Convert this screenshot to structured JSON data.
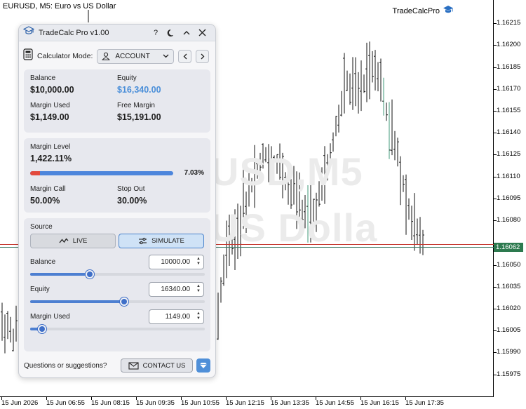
{
  "chart": {
    "symbol_label": "EURUSD, M5:  Euro vs US Dollar",
    "indicator_label": "TradeCalcPro",
    "watermark_line1": "USD,M5",
    "watermark_line2": "US Dolla",
    "current_price": "1.16062",
    "price_ticks": [
      "1.16215",
      "1.16200",
      "1.16185",
      "1.16170",
      "1.16155",
      "1.16140",
      "1.16125",
      "1.16110",
      "1.16095",
      "1.16080",
      "1.16050",
      "1.16035",
      "1.16020",
      "1.16005",
      "1.15990",
      "1.15975"
    ],
    "time_ticks": [
      "15 Jun 2026",
      "15 Jun 06:55",
      "15 Jun 08:15",
      "15 Jun 09:35",
      "15 Jun 10:55",
      "15 Jun 12:15",
      "15 Jun 13:35",
      "15 Jun 14:55",
      "15 Jun 16:15",
      "15 Jun 17:35"
    ],
    "colors": {
      "ask_line": "#c63b32",
      "bid_line": "#3f7a66",
      "price_tag": "#2d7a4f"
    }
  },
  "panel": {
    "title": "TradeCalc Pro v1.00",
    "help_glyph": "?",
    "mode_label": "Calculator Mode:",
    "mode_value": "ACCOUNT",
    "account": {
      "balance_label": "Balance",
      "balance_value": "$10,000.00",
      "equity_label": "Equity",
      "equity_value": "$16,340.00",
      "margin_used_label": "Margin Used",
      "margin_used_value": "$1,149.00",
      "free_margin_label": "Free Margin",
      "free_margin_value": "$15,191.00"
    },
    "margin": {
      "level_label": "Margin Level",
      "level_value": "1,422.11%",
      "bar_percent": "7.03%",
      "bar_fraction": 0.0703,
      "call_label": "Margin Call",
      "call_value": "50.00%",
      "stop_label": "Stop Out",
      "stop_value": "30.00%"
    },
    "source": {
      "label": "Source",
      "live_label": "LIVE",
      "simulate_label": "SIMULATE",
      "active": "SIMULATE"
    },
    "sliders": [
      {
        "label": "Balance",
        "value": "10000.00",
        "fraction": 0.34
      },
      {
        "label": "Equity",
        "value": "16340.00",
        "fraction": 0.54
      },
      {
        "label": "Margin Used",
        "value": "1149.00",
        "fraction": 0.07
      }
    ],
    "footer": {
      "question": "Questions or suggestions?",
      "contact_label": "CONTACT US"
    },
    "accent_color": "#4b8fd9"
  }
}
